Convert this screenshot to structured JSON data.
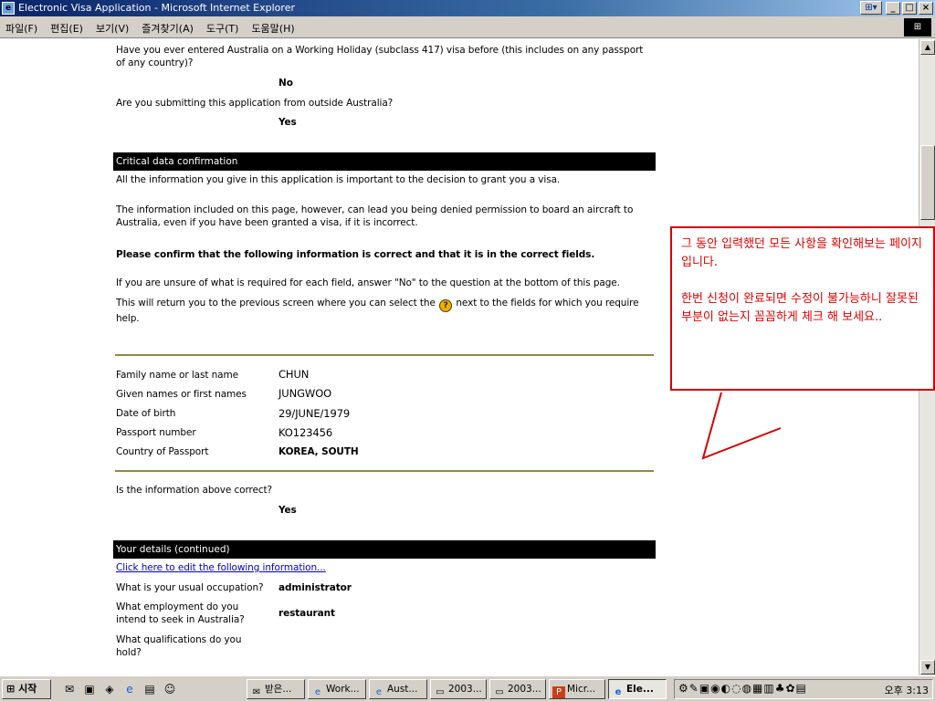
{
  "window": {
    "title": "Electronic Visa Application - Microsoft Internet Explorer",
    "buttons": {
      "minimize": "_",
      "maximize": "□",
      "close": "×"
    }
  },
  "menu": {
    "items": [
      "파일(F)",
      "편집(E)",
      "보기(V)",
      "즐겨찾기(A)",
      "도구(T)",
      "도움말(H)"
    ]
  },
  "form": {
    "q_whv_before": "Have you ever entered Australia on a Working Holiday (subclass 417) visa before (this includes on any passport of any country)?",
    "a_whv_before": "No",
    "q_outside_au": "Are you submitting this application from outside Australia?",
    "a_outside_au": "Yes",
    "critical_title": "Critical data confirmation",
    "critical_p1": "All the information you give in this application is important to the decision to grant you a visa.",
    "critical_p2": "The information included on this page, however, can lead you being denied permission to board an aircraft to Australia, even if you have been granted a visa, if it is incorrect.",
    "critical_p3": "Please confirm that the following information is correct and that it is in the correct fields.",
    "critical_p4": "If you are unsure of what is required for each field, answer \"No\" to the question at the bottom of this page.",
    "critical_p5_pre": "This will return you to the previous screen where you can select the",
    "critical_p5_post": "next to the fields for which you require help.",
    "fields": [
      {
        "label": "Family name or last name",
        "value": "CHUN"
      },
      {
        "label": "Given names or first names",
        "value": "JUNGWOO"
      },
      {
        "label": "Date of birth",
        "value": "29/JUNE/1979"
      },
      {
        "label": "Passport number",
        "value": "KO123456"
      },
      {
        "label": "Country of Passport",
        "value": "KOREA, SOUTH"
      }
    ],
    "q_info_correct": "Is the information above correct?",
    "a_info_correct": "Yes",
    "details_title": "Your details (continued)",
    "edit_link": "Click here to edit the following information...",
    "occupation_label": "What is your usual occupation?",
    "occupation_value": "administrator",
    "employment_label": "What employment do you intend to seek in Australia?",
    "employment_value": "restaurant",
    "qualifications_label": "What qualifications do you hold?"
  },
  "callout": {
    "line1": "그 동안 입력했던 모든 사항을 확인해보는 페이지입니다.",
    "line2": "한번 신청이 완료되면 수정이 불가능하니 잘못된 부분이 없는지 꼼꼼하게 체크 해 보세요.."
  },
  "taskbar": {
    "start_label": "시작",
    "tasks": [
      {
        "label": "받은...",
        "icon": "mail-icon"
      },
      {
        "label": "Work...",
        "icon": "ie-icon"
      },
      {
        "label": "Aust...",
        "icon": "ie-icon"
      },
      {
        "label": "2003...",
        "icon": "app-icon"
      },
      {
        "label": "2003...",
        "icon": "app-icon"
      },
      {
        "label": "Micr...",
        "icon": "powerpoint-icon"
      },
      {
        "label": "Ele...",
        "icon": "ie-icon"
      }
    ],
    "clock": "오후 3:13"
  }
}
